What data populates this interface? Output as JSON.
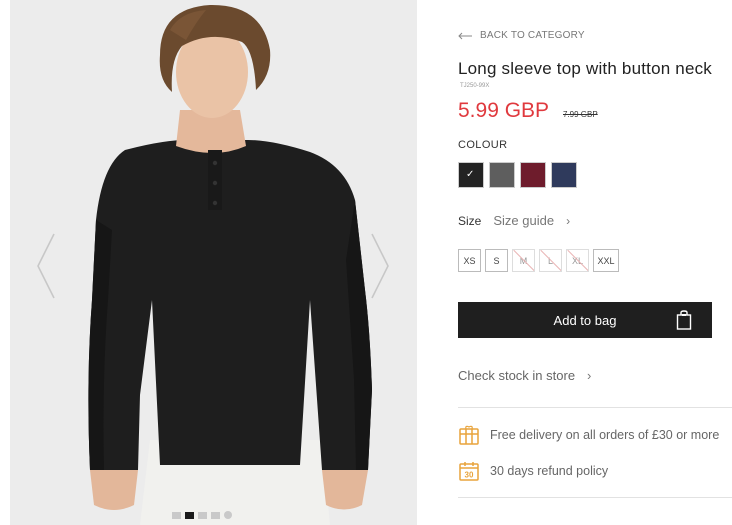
{
  "gallery": {
    "prev_label": "‹",
    "next_label": "›",
    "dots": [
      {
        "active": false
      },
      {
        "active": true
      },
      {
        "active": false
      },
      {
        "active": false
      },
      {
        "active": false
      }
    ]
  },
  "product": {
    "back_label": "BACK TO CATEGORY",
    "title": "Long sleeve top with button neck",
    "sku": "TJ250-99X",
    "price": "5.99 GBP",
    "old_price": "7.99 GBP",
    "colour_label": "COLOUR",
    "colours": [
      {
        "name": "black",
        "hex": "#232323",
        "selected": true
      },
      {
        "name": "grey",
        "hex": "#5e5e5e",
        "selected": false
      },
      {
        "name": "burgundy",
        "hex": "#6e1c2c",
        "selected": false
      },
      {
        "name": "navy",
        "hex": "#2f3a5c",
        "selected": false
      }
    ],
    "size_label": "Size",
    "size_guide_label": "Size guide",
    "sizes": [
      {
        "label": "XS",
        "available": true
      },
      {
        "label": "S",
        "available": true
      },
      {
        "label": "M",
        "available": false
      },
      {
        "label": "L",
        "available": false
      },
      {
        "label": "XL",
        "available": false
      },
      {
        "label": "XXL",
        "available": true
      }
    ],
    "add_to_bag_label": "Add to bag",
    "check_stock_label": "Check stock in store",
    "benefits": {
      "delivery": "Free delivery on all orders of £30 or more",
      "refund": "30 days refund policy",
      "refund_icon_text": "30"
    }
  },
  "colors": {
    "price_red": "#e0393e",
    "button_dark": "#1f1f1f",
    "icon_orange": "#e8a33b"
  }
}
